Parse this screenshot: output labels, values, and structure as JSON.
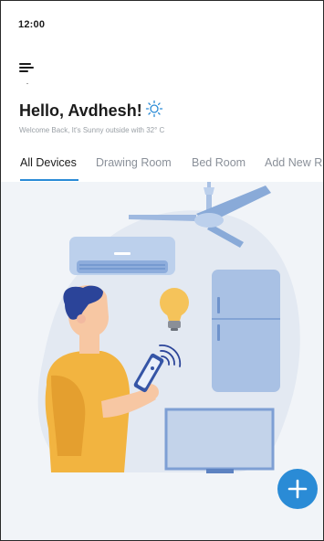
{
  "status_bar": {
    "time": "12:00"
  },
  "header": {
    "greeting": "Hello, Avdhesh!",
    "subtitle": "Welcome Back, It's Sunny outside with 32° C",
    "weather_icon": "sun-icon"
  },
  "tabs": [
    {
      "label": "All Devices",
      "active": true
    },
    {
      "label": "Drawing Room",
      "active": false
    },
    {
      "label": "Bed Room",
      "active": false
    },
    {
      "label": "Add New R",
      "active": false
    }
  ],
  "icons": {
    "menu": "hamburger-menu-icon",
    "add": "plus-icon"
  },
  "colors": {
    "accent": "#2a8bd6",
    "background": "#f1f4f8",
    "blob": "#e3e9f2",
    "device": "#a9c1e4"
  }
}
